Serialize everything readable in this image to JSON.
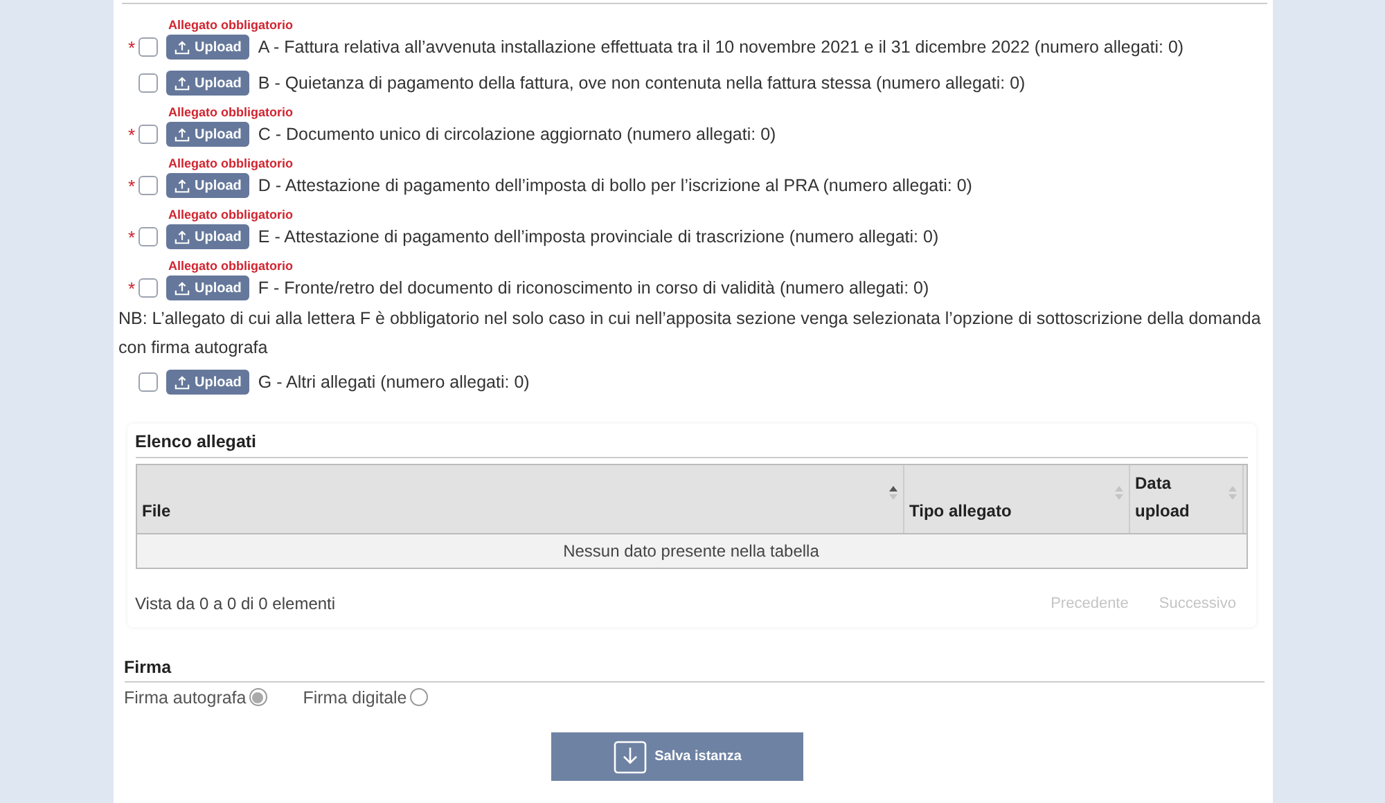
{
  "attachments": [
    {
      "kind": "attachment",
      "required_mark": "*",
      "required_label": "Allegato obbligatorio",
      "checked": false,
      "button": "Upload",
      "text": "A - Fattura relativa all’avvenuta installazione effettuata tra il 10 novembre 2021 e il 31 dicembre 2022 (numero allegati: 0)"
    },
    {
      "kind": "attachment",
      "checked": false,
      "button": "Upload",
      "text": "B - Quietanza di pagamento della fattura, ove non contenuta nella fattura stessa (numero allegati: 0)"
    },
    {
      "kind": "attachment",
      "required_mark": "*",
      "required_label": "Allegato obbligatorio",
      "checked": false,
      "button": "Upload",
      "text": "C - Documento unico di circolazione aggiornato (numero allegati: 0)"
    },
    {
      "kind": "attachment",
      "required_mark": "*",
      "required_label": "Allegato obbligatorio",
      "checked": false,
      "button": "Upload",
      "text": "D - Attestazione di pagamento dell’imposta di bollo per l’iscrizione al PRA (numero allegati: 0)"
    },
    {
      "kind": "attachment",
      "required_mark": "*",
      "required_label": "Allegato obbligatorio",
      "checked": false,
      "button": "Upload",
      "text": "E - Attestazione di pagamento dell’imposta provinciale di trascrizione (numero allegati: 0)"
    },
    {
      "kind": "attachment",
      "required_mark": "*",
      "required_label": "Allegato obbligatorio",
      "checked": false,
      "button": "Upload",
      "text": "F - Fronte/retro del documento di riconoscimento in corso di validità (numero allegati: 0)"
    },
    {
      "kind": "note",
      "text": "NB: L’allegato di cui alla lettera F è obbligatorio nel solo caso in cui nell’apposita sezione venga selezionata l’opzione di sottoscrizione della domanda con firma autografa"
    },
    {
      "kind": "attachment",
      "checked": false,
      "button": "Upload",
      "text": "G - Altri allegati (numero allegati: 0)"
    }
  ],
  "attachment_list": {
    "title": "Elenco allegati",
    "columns": [
      {
        "label": "File",
        "sorted": true
      },
      {
        "label": "Tipo allegato",
        "sorted": false
      },
      {
        "label": "Data upload",
        "sorted": false
      }
    ],
    "empty_message": "Nessun dato presente nella tabella",
    "info": "Vista da 0 a 0 di 0 elementi",
    "pagination": [
      {
        "label": "Precedente",
        "disabled": true
      },
      {
        "label": "Successivo",
        "disabled": true
      }
    ]
  },
  "signature": {
    "title": "Firma",
    "options": [
      {
        "label": "Firma autografa",
        "selected": true
      },
      {
        "label": "Firma digitale",
        "selected": false
      }
    ]
  },
  "save_button": {
    "label": "Salva istanza"
  }
}
